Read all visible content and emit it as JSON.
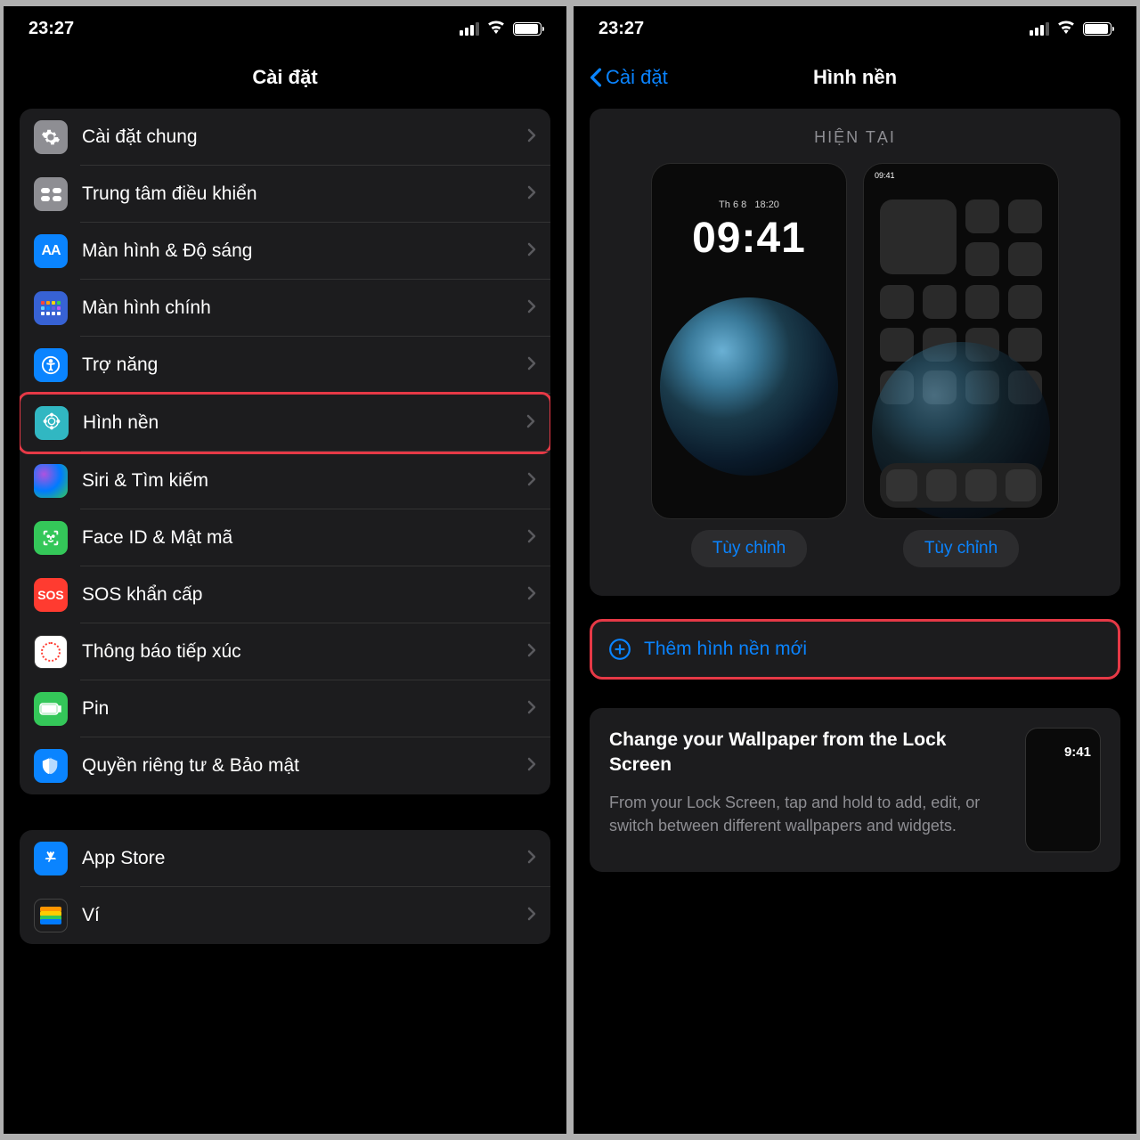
{
  "status": {
    "time": "23:27"
  },
  "left": {
    "title": "Cài đặt",
    "group1": [
      {
        "key": "general",
        "label": "Cài đặt chung",
        "icon": "gear"
      },
      {
        "key": "control",
        "label": "Trung tâm điều khiển",
        "icon": "control"
      },
      {
        "key": "display",
        "label": "Màn hình & Độ sáng",
        "icon": "display",
        "text": "AA"
      },
      {
        "key": "home",
        "label": "Màn hình chính",
        "icon": "home"
      },
      {
        "key": "access",
        "label": "Trợ năng",
        "icon": "access"
      },
      {
        "key": "wallpaper",
        "label": "Hình nền",
        "icon": "wall",
        "highlight": true
      },
      {
        "key": "siri",
        "label": "Siri & Tìm kiếm",
        "icon": "siri"
      },
      {
        "key": "faceid",
        "label": "Face ID & Mật mã",
        "icon": "face"
      },
      {
        "key": "sos",
        "label": "SOS khẩn cấp",
        "icon": "sos",
        "text": "SOS"
      },
      {
        "key": "exposure",
        "label": "Thông báo tiếp xúc",
        "icon": "notif"
      },
      {
        "key": "battery",
        "label": "Pin",
        "icon": "batt"
      },
      {
        "key": "privacy",
        "label": "Quyền riêng tư & Bảo mật",
        "icon": "privacy"
      }
    ],
    "group2": [
      {
        "key": "appstore",
        "label": "App Store",
        "icon": "appstore"
      },
      {
        "key": "wallet",
        "label": "Ví",
        "icon": "wallet"
      }
    ]
  },
  "right": {
    "back": "Cài đặt",
    "title": "Hình nền",
    "current_label": "HIỆN TẠI",
    "lock_date": "Th 6 8   18:20",
    "lock_time": "09:41",
    "home_time": "09:41",
    "customize": "Tùy chỉnh",
    "add_new": "Thêm hình nền mới",
    "tip_title": "Change your Wallpaper from the Lock Screen",
    "tip_desc": "From your Lock Screen, tap and hold to add, edit, or switch between different wallpapers and widgets.",
    "tip_time": "9:41"
  }
}
